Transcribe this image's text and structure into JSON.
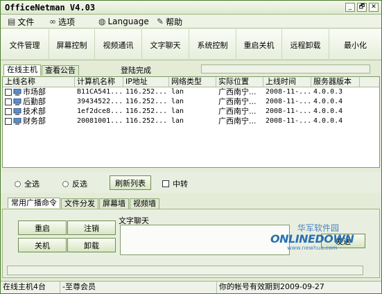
{
  "window": {
    "title": "OfficeNetman V4.03",
    "controls": [
      "_",
      "🗗",
      "✕"
    ]
  },
  "menu": [
    {
      "label": "文件",
      "icon": "file-icon"
    },
    {
      "label": "选项",
      "icon": "glasses-icon"
    },
    {
      "label": "Language",
      "icon": "globe-icon"
    },
    {
      "label": "帮助",
      "icon": "help-book-icon"
    }
  ],
  "toolbar": [
    "文件管理",
    "屏幕控制",
    "视频通讯",
    "文字聊天",
    "系统控制",
    "重启关机",
    "远程卸载",
    "最小化"
  ],
  "top_tabs": [
    "在线主机",
    "查看公告"
  ],
  "login_status": "登陆完成",
  "table": {
    "columns": [
      "上线名称",
      "计算机名称",
      "IP地址",
      "网络类型",
      "实际位置",
      "上线时间",
      "服务器版本"
    ],
    "rows": [
      [
        "市场部",
        "B11CA541...",
        "116.252...",
        "lan",
        "广西南宁...",
        "2008-11-...",
        "4.0.0.3"
      ],
      [
        "后勤部",
        "39434522...",
        "116.252...",
        "lan",
        "广西南宁...",
        "2008-11-...",
        "4.0.0.4"
      ],
      [
        "技术部",
        "1ef2dce8...",
        "116.252...",
        "lan",
        "广西南宁...",
        "2008-11-...",
        "4.0.0.4"
      ],
      [
        "财务部",
        "20081001...",
        "116.252...",
        "lan",
        "广西南宁...",
        "2008-11-...",
        "4.0.0.4"
      ]
    ]
  },
  "selection": {
    "select_all": "全选",
    "invert": "反选",
    "refresh": "刷新列表",
    "relay": "中转"
  },
  "bottom_tabs": [
    "常用广播命令",
    "文件分发",
    "屏幕墙",
    "视频墙"
  ],
  "commands": [
    "重启",
    "注销",
    "关机",
    "卸载"
  ],
  "chat": {
    "label": "文字聊天",
    "send": "发送"
  },
  "watermark": {
    "cn": "华军软件园",
    "logo": "ONLINEDOWN",
    "url": "www.newhua.com"
  },
  "statusbar": [
    "在线主机4台",
    "-至尊会员",
    "你的帐号有效期到2009-09-27"
  ]
}
